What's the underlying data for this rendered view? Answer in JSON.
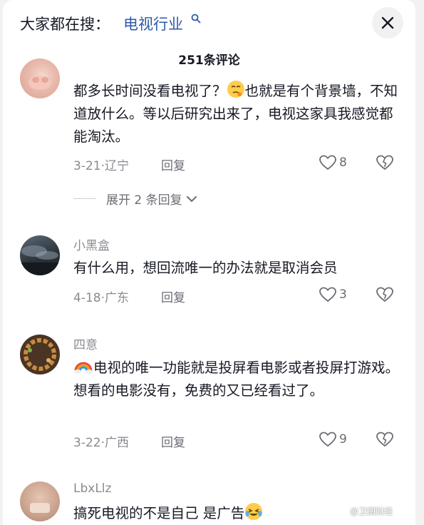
{
  "header": {
    "search_prefix": "大家都在搜：",
    "search_term": "电视行业",
    "comment_count": "251条评论"
  },
  "comments": [
    {
      "username": "",
      "text_before_emoji": "都多长时间没看电视了？",
      "emoji": "thinking-face-emoji",
      "text_after_emoji": "也就是有个背景墙，不知道放什么。等以后研究出来了，电视这家具我感觉都能淘汰。",
      "meta": "3-21·辽宁",
      "reply_label": "回复",
      "likes": "8",
      "expand_replies": "展开 2 条回复"
    },
    {
      "username": "小黑盒",
      "text": "有什么用，想回流唯一的办法就是取消会员",
      "meta": "4-18·广东",
      "reply_label": "回复",
      "likes": "3"
    },
    {
      "username": "四意",
      "emoji": "rainbow-emoji",
      "text": "电视的唯一功能就是投屏看电影或者投屏打游戏。想看的电影没有，免费的又已经看过了。",
      "meta": "3-22·广西",
      "reply_label": "回复",
      "likes": "9"
    },
    {
      "username": "LbxLlz",
      "text": "搞死电视的不是自己 是广告",
      "emoji": "laughing-tears-emoji"
    }
  ],
  "watermark": "@卫国财经",
  "colors": {
    "accent_link": "#2b5aa8",
    "text_primary": "#161823",
    "text_secondary": "#8a8b91"
  }
}
